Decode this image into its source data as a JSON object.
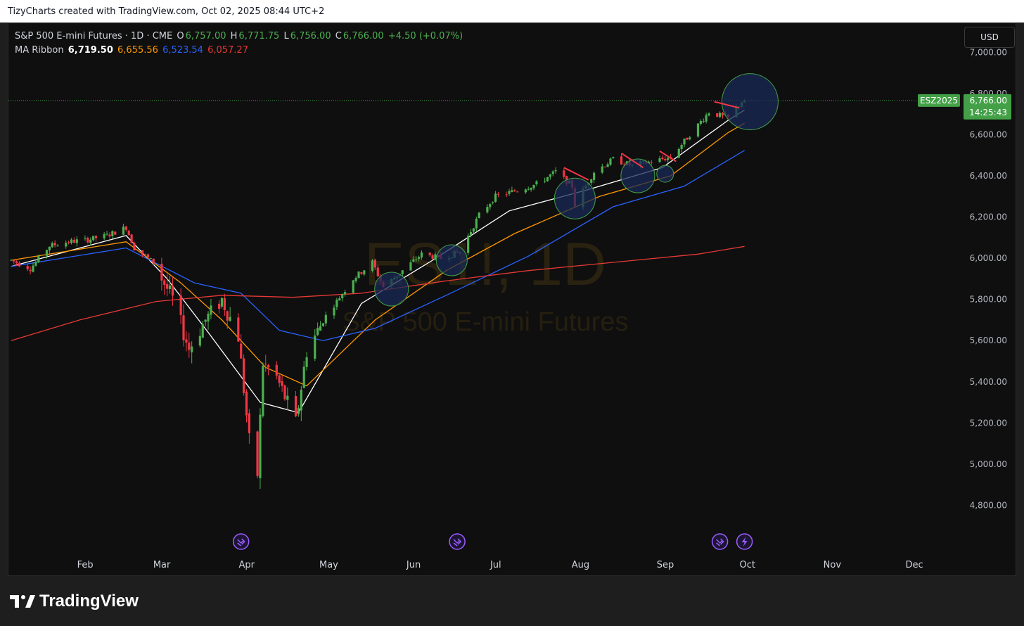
{
  "header": {
    "title": "TizyCharts created with TradingView.com, Oct 02, 2025 08:44 UTC+2"
  },
  "legend": {
    "symbol": "S&P 500 E-mini Futures · 1D · CME",
    "o_label": "O",
    "o_value": "6,757.00",
    "h_label": "H",
    "h_value": "6,771.75",
    "l_label": "L",
    "l_value": "6,756.00",
    "c_label": "C",
    "c_value": "6,766.00",
    "change": "+4.50 (+0.07%)",
    "ma_label": "MA Ribbon",
    "ma_values": [
      "6,719.50",
      "6,655.56",
      "6,523.54",
      "6,057.27"
    ]
  },
  "currency_button": "USD",
  "watermark": {
    "line1": "ES1!, 1D",
    "line2": "S&P 500 E-mini Futures"
  },
  "price_tag": {
    "symbol": "ESZ2025",
    "price": "6,766.00",
    "countdown": "14:25:43"
  },
  "footer": {
    "brand": "TradingView"
  },
  "colors": {
    "up": "#26a69a",
    "up_alt": "#4caf50",
    "down": "#f23645",
    "ma1": "#ffffff",
    "ma2": "#ff9800",
    "ma3": "#2962ff",
    "ma4": "#e53935",
    "circle_fill": "#1a2a55",
    "circle_stroke": "#43a047"
  },
  "chart_data": {
    "type": "candlestick",
    "title": "S&P 500 E-mini Futures · 1D · CME",
    "x_axis_labels": [
      "Feb",
      "Mar",
      "Apr",
      "May",
      "Jun",
      "Jul",
      "Aug",
      "Sep",
      "Oct",
      "Nov",
      "Dec"
    ],
    "y_axis_labels": [
      "7,000.00",
      "6,800.00",
      "6,600.00",
      "6,400.00",
      "6,200.00",
      "6,000.00",
      "5,800.00",
      "5,600.00",
      "5,400.00",
      "5,200.00",
      "5,000.00",
      "4,800.00"
    ],
    "ylim": [
      4740,
      7090
    ],
    "xlim": [
      "2025-01-06",
      "2025-12-20"
    ],
    "close_series": [
      [
        "2025-01-07",
        5990
      ],
      [
        "2025-01-14",
        5950
      ],
      [
        "2025-01-21",
        6060
      ],
      [
        "2025-01-28",
        6080
      ],
      [
        "2025-02-04",
        6090
      ],
      [
        "2025-02-11",
        6110
      ],
      [
        "2025-02-18",
        6150
      ],
      [
        "2025-02-21",
        6050
      ],
      [
        "2025-02-28",
        5980
      ],
      [
        "2025-03-07",
        5800
      ],
      [
        "2025-03-13",
        5560
      ],
      [
        "2025-03-19",
        5700
      ],
      [
        "2025-03-25",
        5800
      ],
      [
        "2025-03-31",
        5620
      ],
      [
        "2025-04-04",
        5110
      ],
      [
        "2025-04-07",
        4950
      ],
      [
        "2025-04-09",
        5490
      ],
      [
        "2025-04-14",
        5420
      ],
      [
        "2025-04-21",
        5200
      ],
      [
        "2025-04-25",
        5550
      ],
      [
        "2025-05-02",
        5720
      ],
      [
        "2025-05-12",
        5900
      ],
      [
        "2025-05-19",
        5980
      ],
      [
        "2025-05-23",
        5860
      ],
      [
        "2025-05-30",
        5940
      ],
      [
        "2025-06-06",
        6020
      ],
      [
        "2025-06-13",
        6000
      ],
      [
        "2025-06-20",
        6030
      ],
      [
        "2025-06-27",
        6210
      ],
      [
        "2025-07-03",
        6300
      ],
      [
        "2025-07-11",
        6330
      ],
      [
        "2025-07-18",
        6360
      ],
      [
        "2025-07-25",
        6420
      ],
      [
        "2025-07-31",
        6350
      ],
      [
        "2025-08-01",
        6260
      ],
      [
        "2025-08-08",
        6420
      ],
      [
        "2025-08-15",
        6480
      ],
      [
        "2025-08-22",
        6450
      ],
      [
        "2025-08-29",
        6470
      ],
      [
        "2025-09-05",
        6490
      ],
      [
        "2025-09-12",
        6600
      ],
      [
        "2025-09-19",
        6710
      ],
      [
        "2025-09-26",
        6680
      ],
      [
        "2025-10-01",
        6761.5
      ],
      [
        "2025-10-02",
        6766
      ]
    ],
    "ohlc_last": {
      "open": 6757.0,
      "high": 6771.75,
      "low": 6756.0,
      "close": 6766.0,
      "change": 4.5,
      "change_pct": 0.07
    },
    "moving_averages": [
      {
        "name": "MA1",
        "last": 6719.5,
        "color": "#ffffff",
        "points": [
          [
            "2025-01-07",
            5960
          ],
          [
            "2025-02-18",
            6110
          ],
          [
            "2025-03-05",
            5900
          ],
          [
            "2025-03-20",
            5640
          ],
          [
            "2025-04-08",
            5300
          ],
          [
            "2025-04-22",
            5250
          ],
          [
            "2025-05-15",
            5780
          ],
          [
            "2025-06-10",
            5990
          ],
          [
            "2025-07-08",
            6230
          ],
          [
            "2025-08-05",
            6330
          ],
          [
            "2025-09-02",
            6440
          ],
          [
            "2025-09-26",
            6670
          ],
          [
            "2025-10-02",
            6719.5
          ]
        ]
      },
      {
        "name": "MA2",
        "last": 6655.56,
        "color": "#ff9800",
        "points": [
          [
            "2025-01-07",
            5990
          ],
          [
            "2025-02-18",
            6080
          ],
          [
            "2025-03-10",
            5880
          ],
          [
            "2025-03-25",
            5700
          ],
          [
            "2025-04-10",
            5470
          ],
          [
            "2025-04-25",
            5380
          ],
          [
            "2025-05-20",
            5700
          ],
          [
            "2025-06-15",
            5940
          ],
          [
            "2025-07-10",
            6120
          ],
          [
            "2025-08-10",
            6300
          ],
          [
            "2025-09-05",
            6400
          ],
          [
            "2025-09-26",
            6610
          ],
          [
            "2025-10-02",
            6655.56
          ]
        ]
      },
      {
        "name": "MA3",
        "last": 6523.54,
        "color": "#2962ff",
        "points": [
          [
            "2025-01-07",
            5960
          ],
          [
            "2025-02-18",
            6050
          ],
          [
            "2025-03-15",
            5880
          ],
          [
            "2025-04-01",
            5830
          ],
          [
            "2025-04-15",
            5650
          ],
          [
            "2025-05-01",
            5600
          ],
          [
            "2025-05-20",
            5660
          ],
          [
            "2025-06-15",
            5820
          ],
          [
            "2025-07-15",
            6010
          ],
          [
            "2025-08-15",
            6250
          ],
          [
            "2025-09-10",
            6350
          ],
          [
            "2025-10-02",
            6523.54
          ]
        ]
      },
      {
        "name": "MA4",
        "last": 6057.27,
        "color": "#e53935",
        "points": [
          [
            "2025-01-07",
            5600
          ],
          [
            "2025-02-01",
            5700
          ],
          [
            "2025-03-01",
            5790
          ],
          [
            "2025-03-25",
            5820
          ],
          [
            "2025-04-20",
            5810
          ],
          [
            "2025-05-15",
            5830
          ],
          [
            "2025-06-15",
            5890
          ],
          [
            "2025-07-15",
            5940
          ],
          [
            "2025-08-15",
            5980
          ],
          [
            "2025-09-15",
            6020
          ],
          [
            "2025-10-02",
            6057.27
          ]
        ]
      }
    ],
    "annotations": {
      "circles": [
        [
          "2025-05-26",
          5850
        ],
        [
          "2025-06-17",
          5990
        ],
        [
          "2025-08-01",
          6290
        ],
        [
          "2025-08-24",
          6400
        ],
        [
          "2025-09-03",
          6410
        ],
        [
          "2025-10-04",
          6760
        ]
      ],
      "red_trendlines": [
        [
          [
            "2025-07-28",
            6440
          ],
          [
            "2025-08-06",
            6380
          ]
        ],
        [
          [
            "2025-08-18",
            6510
          ],
          [
            "2025-08-26",
            6440
          ]
        ],
        [
          [
            "2025-09-01",
            6520
          ],
          [
            "2025-09-07",
            6470
          ]
        ],
        [
          [
            "2025-09-21",
            6760
          ],
          [
            "2025-09-30",
            6730
          ]
        ]
      ],
      "event_icons": [
        "2025-04-01",
        "2025-06-19",
        "2025-09-23",
        "2025-10-02"
      ]
    },
    "grid": false,
    "legend_position": "top-left"
  }
}
